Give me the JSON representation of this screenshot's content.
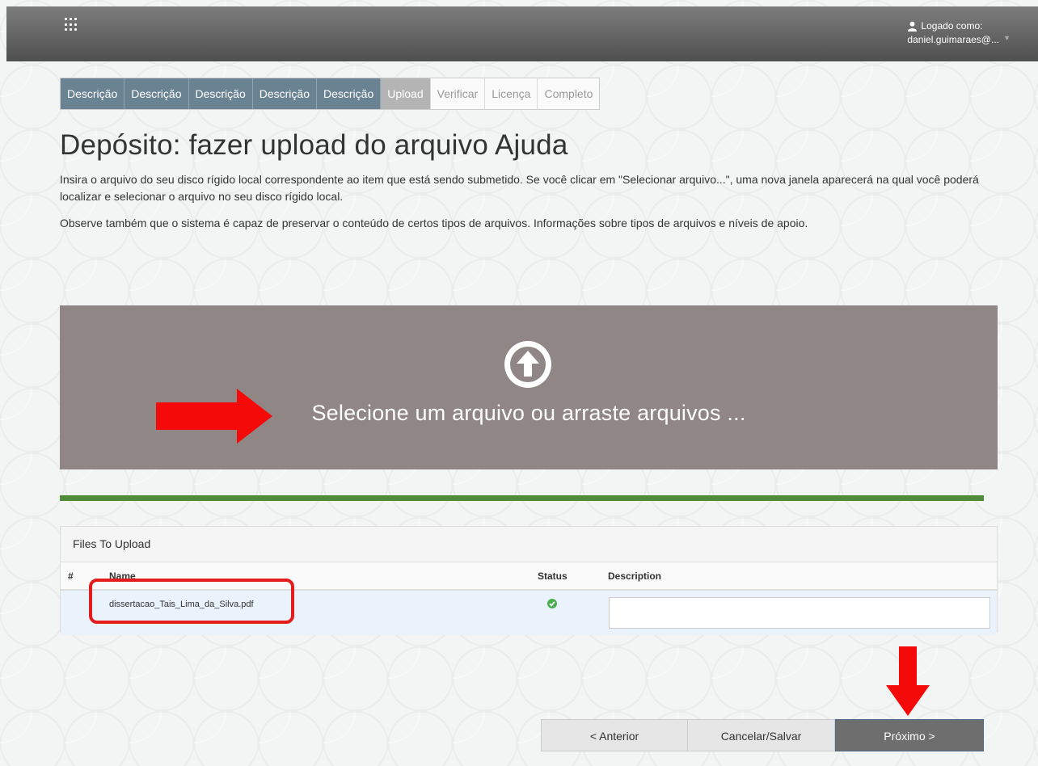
{
  "header": {
    "user_label": "Logado como:",
    "user_email": "daniel.guimaraes@..."
  },
  "steps": [
    {
      "label": "Descrição",
      "state": "done"
    },
    {
      "label": "Descrição",
      "state": "done"
    },
    {
      "label": "Descrição",
      "state": "done"
    },
    {
      "label": "Descrição",
      "state": "done"
    },
    {
      "label": "Descrição",
      "state": "done"
    },
    {
      "label": "Upload",
      "state": "active"
    },
    {
      "label": "Verificar",
      "state": "todo"
    },
    {
      "label": "Licença",
      "state": "todo"
    },
    {
      "label": "Completo",
      "state": "todo"
    }
  ],
  "page": {
    "title": "Depósito: fazer upload do arquivo Ajuda",
    "paragraph1": "Insira o arquivo do seu disco rígido local correspondente ao item que está sendo submetido. Se você clicar em \"Selecionar arquivo...\", uma nova janela aparecerá na qual você poderá localizar e selecionar o arquivo no seu disco rígido local.",
    "paragraph2": "Observe também que o sistema é capaz de preservar o conteúdo de certos tipos de arquivos. Informações sobre tipos de arquivos e níveis de apoio."
  },
  "dropzone": {
    "text": "Selecione um arquivo ou arraste arquivos ...",
    "icon": "upload-circle-icon"
  },
  "upload_progress": 1.0,
  "files_panel": {
    "heading": "Files To Upload",
    "columns": [
      "#",
      "Name",
      "Status",
      "Description"
    ],
    "rows": [
      {
        "index": "",
        "name": "dissertacao_Tais_Lima_da_Silva.pdf",
        "status": "success",
        "description": ""
      }
    ]
  },
  "nav_buttons": {
    "prev": "< Anterior",
    "cancel": "Cancelar/Salvar",
    "next": "Próximo >"
  },
  "colors": {
    "topbar": "#5e5e5e",
    "step_done": "#6a8393",
    "dropzone": "#8f8685",
    "progress": "#4f8b3a",
    "annotation_red": "#e41c1c"
  }
}
